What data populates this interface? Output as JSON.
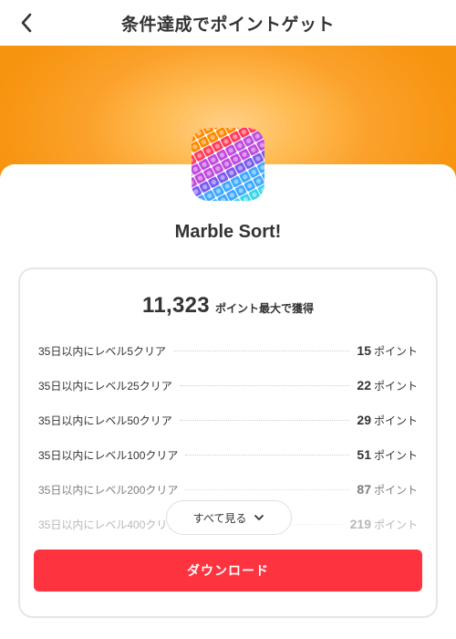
{
  "header": {
    "title": "条件達成でポイントゲット",
    "back_icon": "chevron-left-icon"
  },
  "colors": {
    "banner_orange": "#f7940f",
    "banner_light": "#ffd08a",
    "download_red": "#fe3340",
    "text_primary": "#333333",
    "text_faded": "#b8b8b8"
  },
  "app": {
    "name": "Marble Sort!",
    "icon": "marble-sort-app-icon"
  },
  "summary": {
    "total_points": "11,323",
    "total_label": "ポイント最大で獲得"
  },
  "tasks": [
    {
      "label": "35日以内にレベル5クリア",
      "points": "15",
      "unit": "ポイント"
    },
    {
      "label": "35日以内にレベル25クリア",
      "points": "22",
      "unit": "ポイント"
    },
    {
      "label": "35日以内にレベル50クリア",
      "points": "29",
      "unit": "ポイント"
    },
    {
      "label": "35日以内にレベル100クリア",
      "points": "51",
      "unit": "ポイント"
    },
    {
      "label": "35日以内にレベル200クリア",
      "points": "87",
      "unit": "ポイント"
    },
    {
      "label": "35日以内にレベル400クリア",
      "points": "219",
      "unit": "ポイント"
    }
  ],
  "see_all": {
    "label": "すべて見る",
    "icon": "chevron-down-icon"
  },
  "download": {
    "label": "ダウンロード"
  }
}
